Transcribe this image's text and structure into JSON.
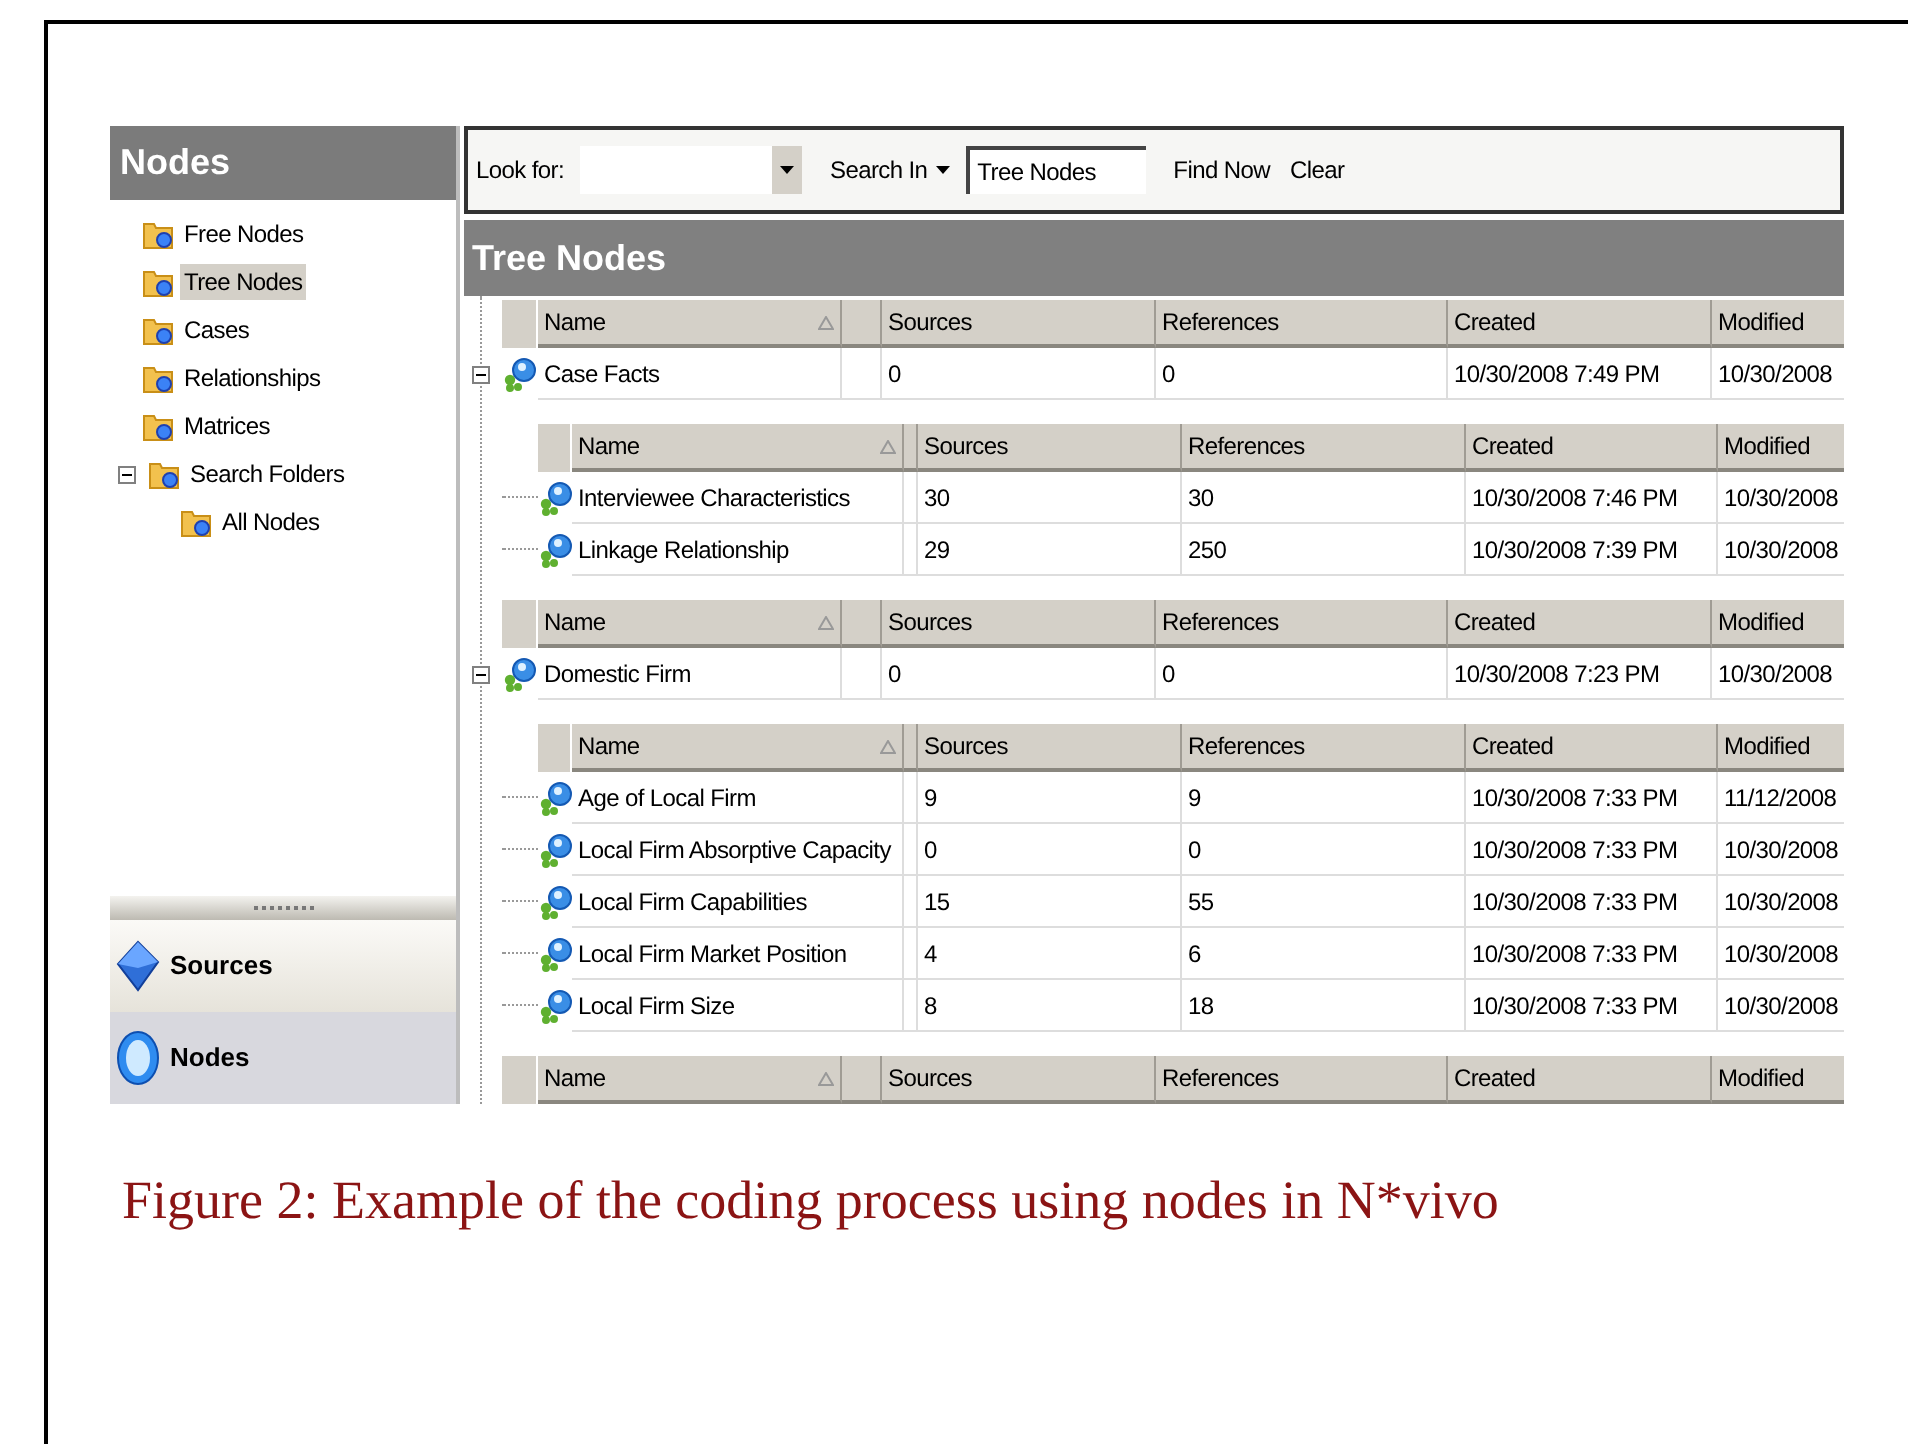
{
  "navigation": {
    "title": "Nodes",
    "items": [
      {
        "label": "Free Nodes",
        "selected": false
      },
      {
        "label": "Tree Nodes",
        "selected": true
      },
      {
        "label": "Cases",
        "selected": false
      },
      {
        "label": "Relationships",
        "selected": false
      },
      {
        "label": "Matrices",
        "selected": false
      },
      {
        "label": "Search Folders",
        "selected": false,
        "expanded": true,
        "children": [
          {
            "label": "All Nodes",
            "selected": false
          }
        ]
      }
    ],
    "buttons": [
      {
        "label": "Sources",
        "kind": "cube",
        "selected": false
      },
      {
        "label": "Nodes",
        "kind": "orb",
        "selected": true
      }
    ]
  },
  "find_bar": {
    "look_for_label": "Look for:",
    "search_in_label": "Search In",
    "search_in_value": "Tree Nodes",
    "find_now": "Find Now",
    "clear": "Clear"
  },
  "list_view": {
    "title": "Tree Nodes",
    "groups": [
      {
        "columns": [
          "Name",
          "Sources",
          "References",
          "Created",
          "Modified"
        ],
        "rows": [
          {
            "name": "Case Facts",
            "sources": "0",
            "references": "0",
            "created": "10/30/2008 7:49 PM",
            "modified": "10/30/2008",
            "expanded": true,
            "children": {
              "columns": [
                "Name",
                "Sources",
                "References",
                "Created",
                "Modified"
              ],
              "rows": [
                {
                  "name": "Interviewee Characteristics",
                  "sources": "30",
                  "references": "30",
                  "created": "10/30/2008 7:46 PM",
                  "modified": "10/30/2008"
                },
                {
                  "name": "Linkage Relationship",
                  "sources": "29",
                  "references": "250",
                  "created": "10/30/2008 7:39 PM",
                  "modified": "10/30/2008"
                }
              ]
            }
          }
        ]
      },
      {
        "columns": [
          "Name",
          "Sources",
          "References",
          "Created",
          "Modified"
        ],
        "rows": [
          {
            "name": "Domestic Firm",
            "sources": "0",
            "references": "0",
            "created": "10/30/2008 7:23 PM",
            "modified": "10/30/2008",
            "expanded": true,
            "children": {
              "columns": [
                "Name",
                "Sources",
                "References",
                "Created",
                "Modified"
              ],
              "rows": [
                {
                  "name": "Age of Local Firm",
                  "sources": "9",
                  "references": "9",
                  "created": "10/30/2008 7:33 PM",
                  "modified": "11/12/2008"
                },
                {
                  "name": "Local Firm Absorptive Capacity",
                  "sources": "0",
                  "references": "0",
                  "created": "10/30/2008 7:33 PM",
                  "modified": "10/30/2008"
                },
                {
                  "name": "Local Firm Capabilities",
                  "sources": "15",
                  "references": "55",
                  "created": "10/30/2008 7:33 PM",
                  "modified": "10/30/2008"
                },
                {
                  "name": "Local Firm Market Position",
                  "sources": "4",
                  "references": "6",
                  "created": "10/30/2008 7:33 PM",
                  "modified": "10/30/2008"
                },
                {
                  "name": "Local Firm Size",
                  "sources": "8",
                  "references": "18",
                  "created": "10/30/2008 7:33 PM",
                  "modified": "10/30/2008"
                }
              ]
            }
          }
        ]
      },
      {
        "columns": [
          "Name",
          "Sources",
          "References",
          "Created",
          "Modified"
        ]
      }
    ]
  },
  "caption": "Figure 2: Example of the coding process using nodes in N*vivo"
}
